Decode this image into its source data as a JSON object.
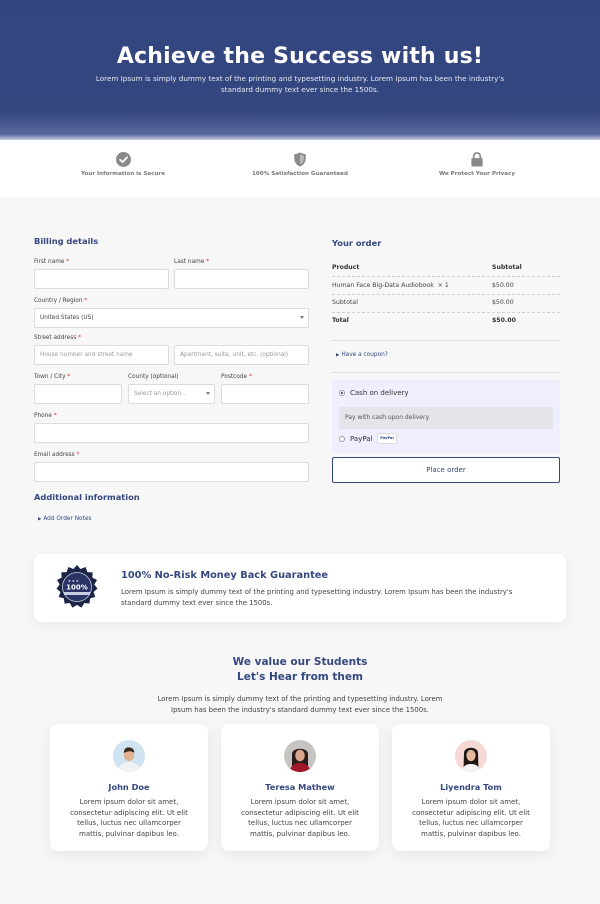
{
  "hero": {
    "title": "Achieve the Success with us!",
    "subtitle": "Lorem Ipsum is simply dummy text of the printing and typesetting industry. Lorem Ipsum has been the industry's standard dummy text ever since the 1500s."
  },
  "trust": [
    {
      "icon": "check-circle-icon",
      "label": "Your Information is Secure"
    },
    {
      "icon": "shield-icon",
      "label": "100% Satisfaction Guaranteed"
    },
    {
      "icon": "lock-icon",
      "label": "We Protect Your Privacy"
    }
  ],
  "billing": {
    "title": "Billing details",
    "first_name_label": "First name",
    "last_name_label": "Last name",
    "country_label": "Country / Region",
    "country_value": "United States (US)",
    "street_label": "Street address",
    "street_placeholder": "House number and street name",
    "apt_placeholder": "Apartment, suite, unit, etc. (optional)",
    "city_label": "Town / City",
    "county_label": "County (optional)",
    "county_placeholder": "Select an option...",
    "postcode_label": "Postcode",
    "phone_label": "Phone",
    "email_label": "Email address",
    "required_mark": "*"
  },
  "additional": {
    "title": "Additional information",
    "notes_link": "Add Order Notes"
  },
  "order": {
    "title": "Your order",
    "col_product": "Product",
    "col_subtotal": "Subtotal",
    "item_name": "Human Face Big-Data Audiobook",
    "item_qty": "× 1",
    "item_price": "$50.00",
    "subtotal_label": "Subtotal",
    "subtotal_value": "$50.00",
    "total_label": "Total",
    "total_value": "$50.00",
    "coupon_link": "Have a coupon?",
    "pay_cod": "Cash on delivery",
    "pay_cod_note": "Pay with cash upon delivery.",
    "pay_paypal": "PayPal",
    "paypal_badge": "PayPal",
    "place_order": "Place order"
  },
  "guarantee": {
    "badge_text": "100%",
    "title": "100% No-Risk Money Back Guarantee",
    "text": "Lorem Ipsum is simply dummy text of the printing and typesetting industry. Lorem Ipsum has been the industry's standard dummy text ever since the 1500s."
  },
  "students": {
    "title_line1": "We value our Students",
    "title_line2": "Let's Hear from them",
    "intro": "Lorem Ipsum is simply dummy text of the printing and typesetting industry. Lorem Ipsum has been the industry's standard dummy text ever since the 1500s.",
    "cards": [
      {
        "name": "John Doe",
        "text": "Lorem ipsum dolor sit amet, consectetur adipiscing elit. Ut elit tellus, luctus nec ullamcorper mattis, pulvinar dapibus leo."
      },
      {
        "name": "Teresa Mathew",
        "text": "Lorem ipsum dolor sit amet, consectetur adipiscing elit. Ut elit tellus, luctus nec ullamcorper mattis, pulvinar dapibus leo."
      },
      {
        "name": "Liyendra Tom",
        "text": "Lorem ipsum dolor sit amet, consectetur adipiscing elit. Ut elit tellus, luctus nec ullamcorper mattis, pulvinar dapibus leo."
      }
    ]
  },
  "colors": {
    "brand": "#34477f",
    "required": "#dd3333",
    "payment_bg": "#eeeeff"
  }
}
